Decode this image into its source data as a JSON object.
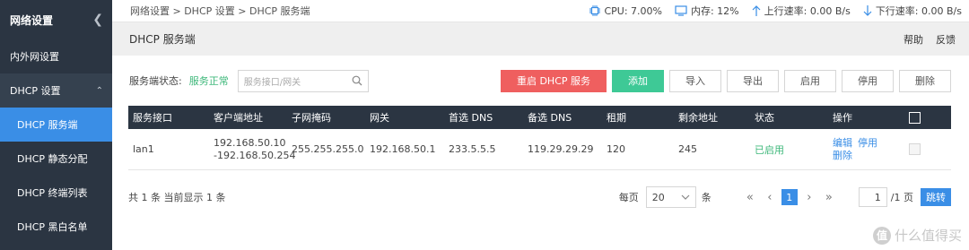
{
  "sidebar": {
    "title": "网络设置",
    "items": [
      {
        "label": "内外网设置"
      }
    ],
    "group": {
      "label": "DHCP 设置"
    },
    "subitems": [
      {
        "label": "DHCP 服务端",
        "active": true
      },
      {
        "label": "DHCP 静态分配"
      },
      {
        "label": "DHCP 终端列表"
      },
      {
        "label": "DHCP 黑白名单"
      }
    ]
  },
  "topbar": {
    "breadcrumb": "网络设置 > DHCP 设置 > DHCP 服务端",
    "cpu": "CPU: 7.00%",
    "memory": "内存: 12%",
    "upload": "上行速率: 0.00 B/s",
    "download": "下行速率: 0.00 B/s"
  },
  "header": {
    "title": "DHCP 服务端",
    "help": "帮助",
    "feedback": "反馈"
  },
  "toolbar": {
    "status_label": "服务端状态:",
    "status_value": "服务正常",
    "search_placeholder": "服务接口/网关",
    "restart": "重启 DHCP 服务",
    "add": "添加",
    "import": "导入",
    "export": "导出",
    "enable": "启用",
    "disable": "停用",
    "delete": "删除"
  },
  "table": {
    "headers": [
      "服务接口",
      "客户端地址",
      "子网掩码",
      "网关",
      "首选 DNS",
      "备选 DNS",
      "租期",
      "剩余地址",
      "状态",
      "操作"
    ],
    "rows": [
      {
        "interface": "lan1",
        "range_start": "192.168.50.10",
        "range_end": "-192.168.50.254",
        "netmask": "255.255.255.0",
        "gateway": "192.168.50.1",
        "dns1": "233.5.5.5",
        "dns2": "119.29.29.29",
        "lease": "120",
        "remaining": "245",
        "status": "已启用",
        "op_edit": "编辑",
        "op_disable": "停用",
        "op_delete": "删除"
      }
    ]
  },
  "footer": {
    "summary": "共 1 条 当前显示 1 条",
    "per_page_label": "每页",
    "per_page_value": "20",
    "per_page_unit": "条",
    "current_page": "1",
    "goto_value": "1",
    "total_pages": "/1 页",
    "go": "跳转"
  },
  "watermark": {
    "badge": "值",
    "text": "什么值得买"
  },
  "colors": {
    "sidebar_bg": "#2b3542",
    "active_blue": "#3a8ee6",
    "red_button": "#ef5f5f",
    "green_button": "#3ec996",
    "status_green": "#3fb87b"
  }
}
